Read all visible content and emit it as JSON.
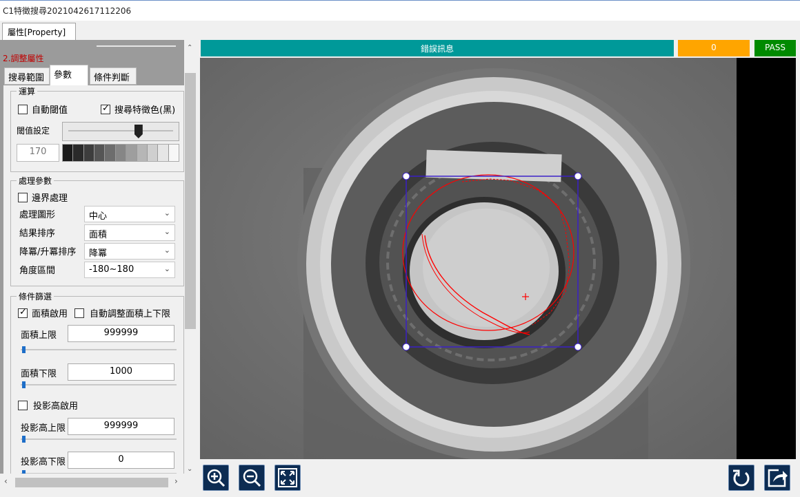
{
  "window": {
    "title": "C1特徵搜尋2021042617112206"
  },
  "main_tab": {
    "label": "屬性[Property]"
  },
  "section": {
    "title": "2.調整屬性"
  },
  "inner_tabs": [
    {
      "label": "搜尋範圍"
    },
    {
      "label": "參數"
    },
    {
      "label": "條件判斷"
    }
  ],
  "group_compute": {
    "title": "運算",
    "auto_threshold_label": "自動閾值",
    "auto_threshold_checked": false,
    "search_black_label": "搜尋特徵色(黑)",
    "search_black_checked": true,
    "threshold_label": "閾值設定",
    "threshold_value": "170",
    "threshold_fraction": 0.67
  },
  "group_processing": {
    "title": "處理參數",
    "border_label": "邊界處理",
    "border_checked": false,
    "rows": [
      {
        "label": "處理圖形",
        "value": "中心"
      },
      {
        "label": "結果排序",
        "value": "面積"
      },
      {
        "label": "降冪/升冪排序",
        "value": "降冪"
      },
      {
        "label": "角度區間",
        "value": "-180~180"
      }
    ]
  },
  "group_filter": {
    "title": "條件篩選",
    "area_enable_label": "面積啟用",
    "area_enable_checked": true,
    "auto_area_label": "自動調整面積上下限",
    "auto_area_checked": false,
    "area_max_label": "面積上限",
    "area_max_value": "999999",
    "area_min_label": "面積下限",
    "area_min_value": "1000",
    "proj_enable_label": "投影高啟用",
    "proj_enable_checked": false,
    "proj_max_label": "投影高上限",
    "proj_max_value": "999999",
    "proj_min_label": "投影高下限",
    "proj_min_value": "0"
  },
  "status": {
    "message_label": "錯誤訊息",
    "count": "0",
    "result": "PASS",
    "colors": {
      "message": "#009999",
      "count": "#ffa500",
      "result": "#008a00"
    }
  },
  "toolbar": {
    "zoom_in": "zoom-in-icon",
    "zoom_out": "zoom-out-icon",
    "fit": "fit-screen-icon",
    "reset": "rotate-reset-icon",
    "export": "export-icon"
  }
}
